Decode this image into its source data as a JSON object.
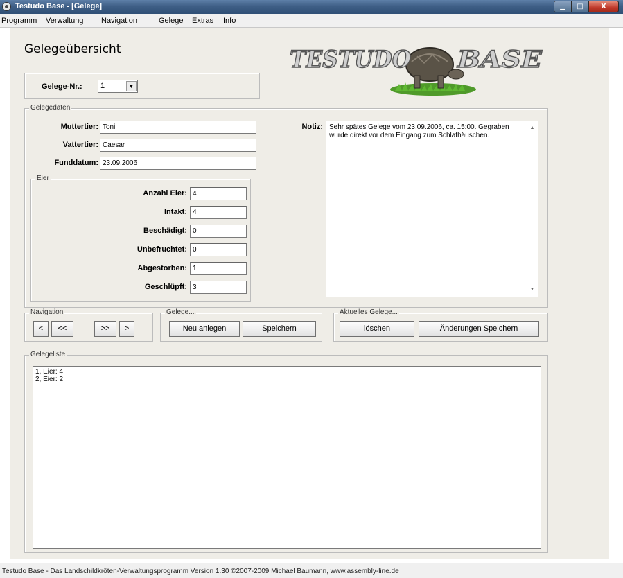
{
  "window": {
    "title": "Testudo Base - [Gelege]",
    "min_glyph": "▁",
    "max_glyph": "□",
    "close_glyph": "X"
  },
  "menu": [
    "Programm",
    "Verwaltung",
    "Navigation",
    "Gelege",
    "Extras",
    "Info"
  ],
  "page": {
    "title": "Gelegeübersicht"
  },
  "logo": {
    "text": "TESTUDO BASE"
  },
  "gelege_nr": {
    "label": "Gelege-Nr.:",
    "value": "1"
  },
  "gelegedaten": {
    "legend": "Gelegedaten",
    "muttertier": {
      "label": "Muttertier:",
      "value": "Toni"
    },
    "vattertier": {
      "label": "Vattertier:",
      "value": "Caesar"
    },
    "funddatum": {
      "label": "Funddatum:",
      "value": "23.09.2006"
    },
    "notiz": {
      "label": "Notiz:",
      "value": "Sehr spätes Gelege vom 23.09.2006, ca. 15:00. Gegraben wurde direkt vor dem Eingang zum Schlafhäuschen."
    }
  },
  "eier": {
    "legend": "Eier",
    "anzahl": {
      "label": "Anzahl Eier:",
      "value": "4"
    },
    "intakt": {
      "label": "Intakt:",
      "value": "4"
    },
    "beschaedigt": {
      "label": "Beschädigt:",
      "value": "0"
    },
    "unbefruchtet": {
      "label": "Unbefruchtet:",
      "value": "0"
    },
    "abgestorben": {
      "label": "Abgestorben:",
      "value": "1"
    },
    "geschluepft": {
      "label": "Geschlüpft:",
      "value": "3"
    }
  },
  "navigation": {
    "legend": "Navigation",
    "first": "<",
    "prev": "<<",
    "next": ">>",
    "last": ">"
  },
  "gelege_actions": {
    "legend": "Gelege...",
    "new": "Neu anlegen",
    "save": "Speichern"
  },
  "aktuelles": {
    "legend": "Aktuelles Gelege...",
    "delete": "löschen",
    "save_changes": "Änderungen Speichern"
  },
  "gelegeliste": {
    "legend": "Gelegeliste",
    "items": [
      "1, Eier: 4",
      "2, Eier: 2"
    ]
  },
  "status": {
    "text": "Testudo Base - Das Landschildkröten-Verwaltungsprogramm Version 1.30 ©2007-2009 Michael Baumann, www.assembly-line.de"
  },
  "colors": {
    "titlebar": "#3f5f86",
    "panel": "#efede7",
    "close_button": "#c0392b"
  }
}
